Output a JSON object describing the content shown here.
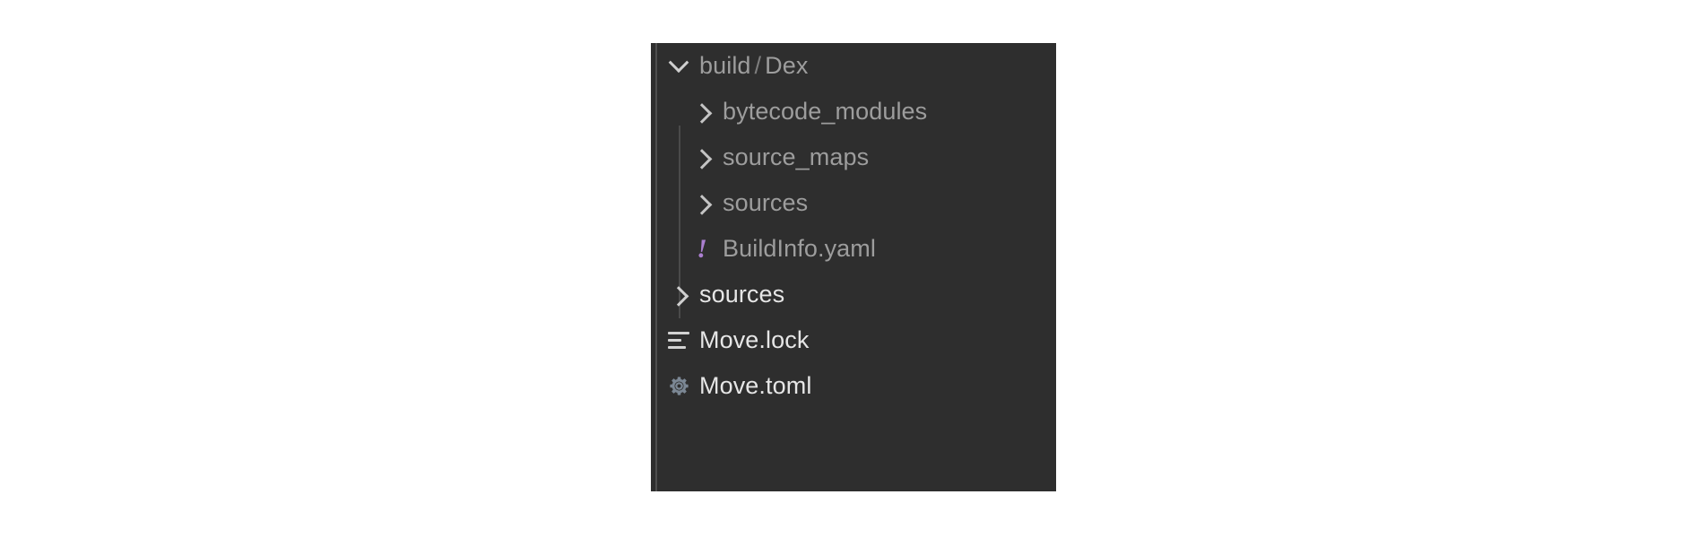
{
  "panel": {
    "name": "file-explorer-tree",
    "background_color": "#2e2e2e",
    "canvas_background_color": "#ffffff",
    "indent_guide_color": "#4e4e4e"
  },
  "colors": {
    "dim_text": "#9d9d9d",
    "bright_text": "#e6e6e6",
    "chevron": "#cfcfcf",
    "path_separator": "#7e7e7e",
    "yaml_icon": "#ab7fd0",
    "gear_icon": "#7b8794",
    "lines_icon": "#d2d2d2"
  },
  "tree": {
    "rows": [
      {
        "label": "build",
        "path_separator": "/",
        "label_suffix": "Dex",
        "icon": "chevron-down-icon",
        "expanded": true,
        "depth": 0,
        "emphasis": "dim"
      },
      {
        "label": "bytecode_modules",
        "icon": "chevron-right-icon",
        "expanded": false,
        "depth": 1,
        "emphasis": "dim"
      },
      {
        "label": "source_maps",
        "icon": "chevron-right-icon",
        "expanded": false,
        "depth": 1,
        "emphasis": "dim"
      },
      {
        "label": "sources",
        "icon": "chevron-right-icon",
        "expanded": false,
        "depth": 1,
        "emphasis": "dim"
      },
      {
        "label": "BuildInfo.yaml",
        "icon": "yaml-file-icon",
        "depth": 1,
        "emphasis": "dim"
      },
      {
        "label": "sources",
        "icon": "chevron-right-icon",
        "expanded": false,
        "depth": 0,
        "emphasis": "bright"
      },
      {
        "label": "Move.lock",
        "icon": "lock-file-lines-icon",
        "depth": 0,
        "emphasis": "bright"
      },
      {
        "label": "Move.toml",
        "icon": "gear-icon",
        "depth": 0,
        "emphasis": "bright"
      }
    ]
  }
}
